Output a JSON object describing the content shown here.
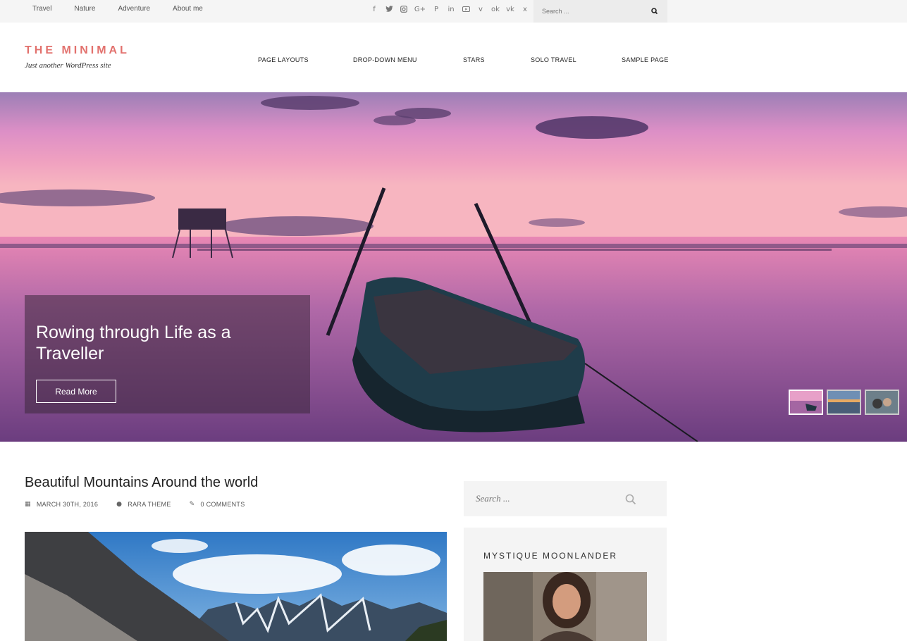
{
  "topbar": {
    "nav": [
      "Travel",
      "Nature",
      "Adventure",
      "About me"
    ],
    "social_icons": [
      "facebook-icon",
      "twitter-icon",
      "instagram-icon",
      "google-plus-icon",
      "pinterest-icon",
      "linkedin-icon",
      "youtube-icon",
      "vimeo-icon",
      "odnoklassniki-icon",
      "vk-icon",
      "xing-icon"
    ],
    "search_placeholder": "Search ..."
  },
  "header": {
    "site_title": "THE MINIMAL",
    "tagline": "Just another WordPress site",
    "menu": [
      "PAGE LAYOUTS",
      "DROP-DOWN MENU",
      "STARS",
      "SOLO TRAVEL",
      "SAMPLE PAGE"
    ]
  },
  "hero": {
    "title": "Rowing through Life as a Traveller",
    "button": "Read More",
    "slides": 3,
    "active_slide": 1
  },
  "post": {
    "title": "Beautiful Mountains Around the world",
    "date": "MARCH 30TH, 2016",
    "author": "RARA THEME",
    "comments": "0 COMMENTS"
  },
  "sidebar": {
    "search_placeholder": "Search ...",
    "widget_title": "MYSTIQUE MOONLANDER"
  },
  "colors": {
    "brand": "#e2716d",
    "topbar_bg": "#f5f5f5",
    "sidebar_bg": "#f4f4f4"
  }
}
